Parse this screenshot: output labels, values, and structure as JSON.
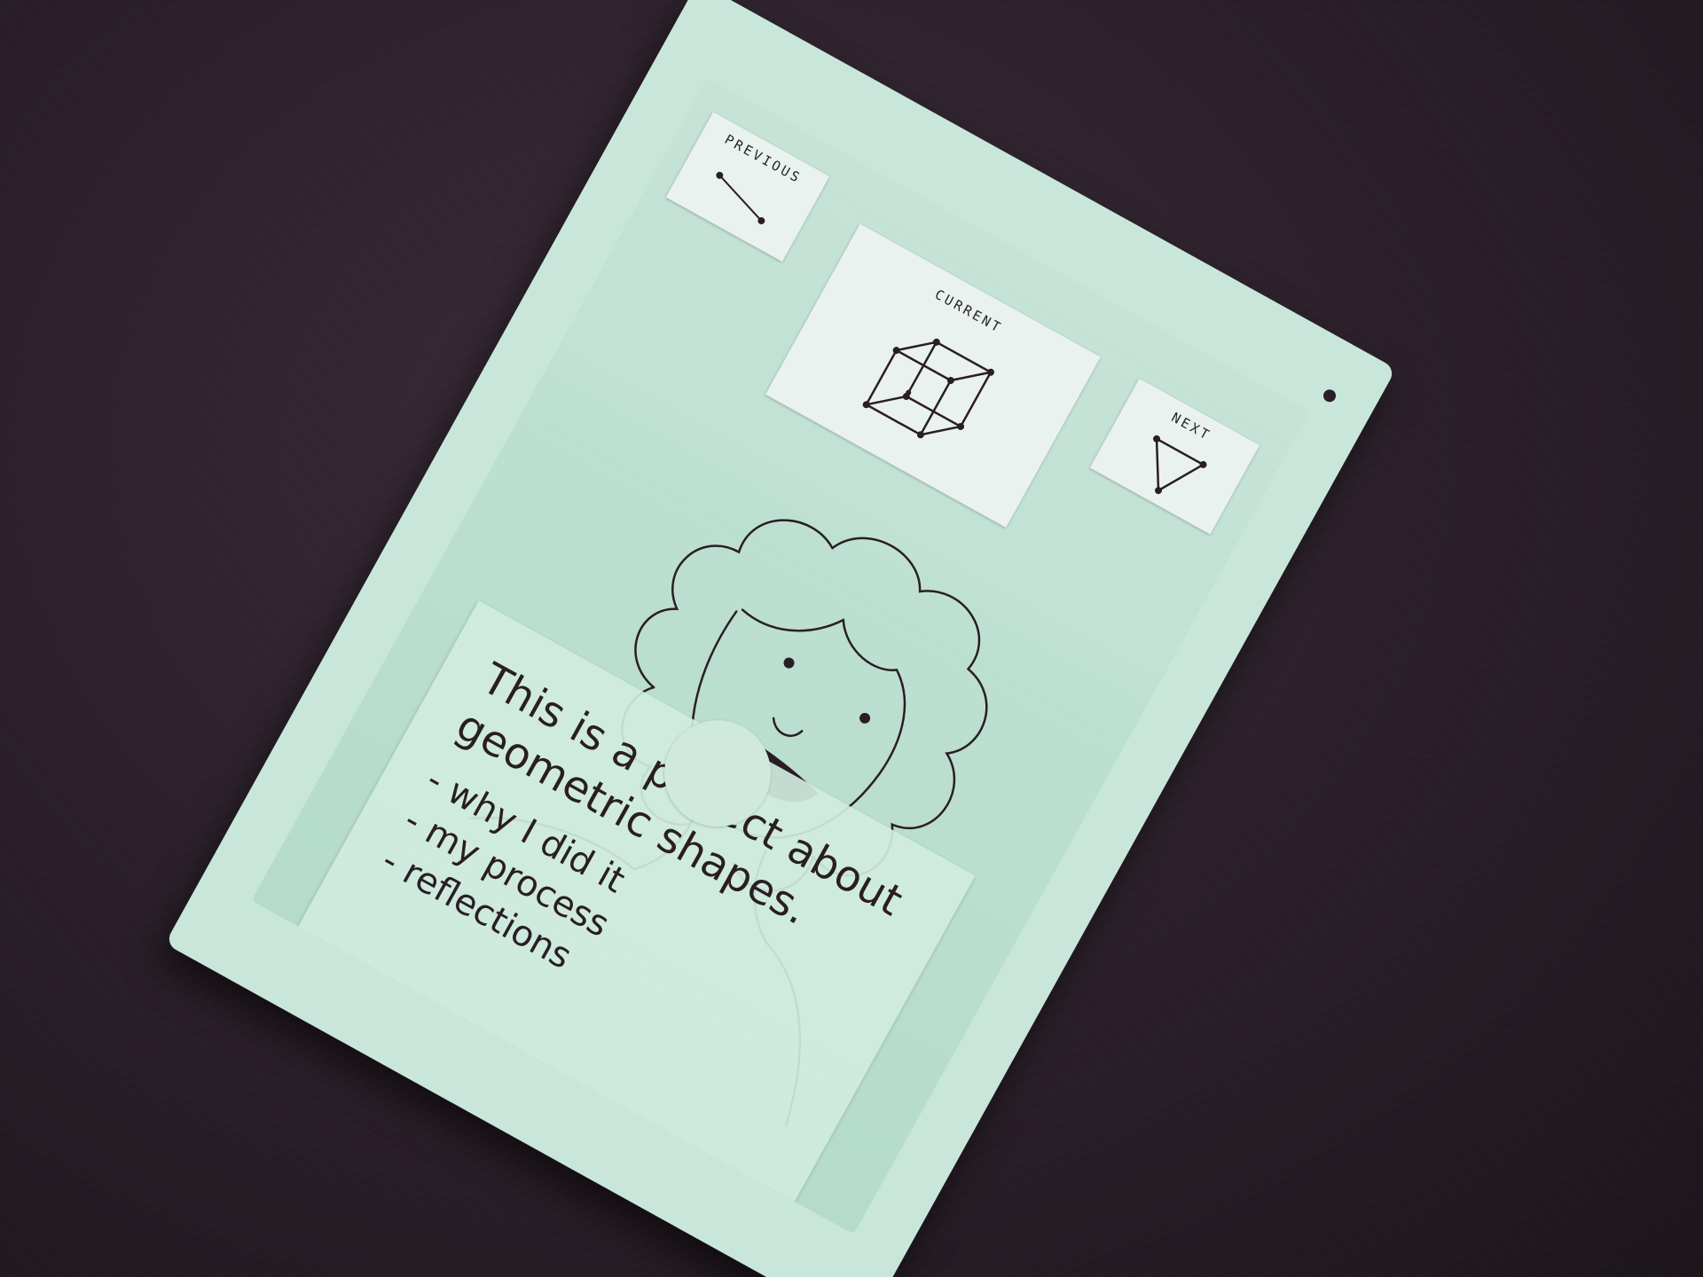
{
  "nav": {
    "previous": {
      "label": "PREVIOUS",
      "icon": "line-segment-icon"
    },
    "current": {
      "label": "CURRENT",
      "icon": "cube-icon"
    },
    "next": {
      "label": "NEXT",
      "icon": "triangle-icon"
    }
  },
  "portrait": {
    "icon": "person-portrait-icon"
  },
  "info": {
    "title": "This is a project about geometric shapes.",
    "items": [
      "why I did it",
      "my process",
      "reflections"
    ]
  },
  "home_button": {
    "icon": "circle-home-button"
  },
  "colors": {
    "paper_mint": "#c9e6da",
    "screen_mint": "#a8d6c2",
    "ink": "#2a1e22",
    "desk": "#2a1f29"
  }
}
